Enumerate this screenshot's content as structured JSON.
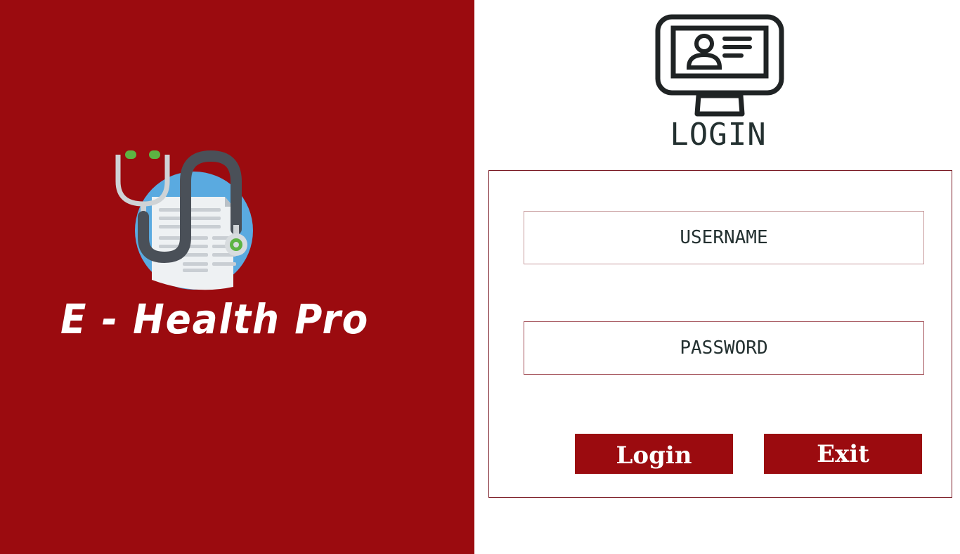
{
  "brand": {
    "app_name": "E - Health Pro",
    "primary_color": "#9b0b0f",
    "logo_icon": "stethoscope-document-icon"
  },
  "login": {
    "title": "LOGIN",
    "title_icon": "monitor-id-card-icon",
    "username_placeholder": "USERNAME",
    "password_placeholder": "PASSWORD",
    "login_button": "Login",
    "exit_button": "Exit"
  }
}
